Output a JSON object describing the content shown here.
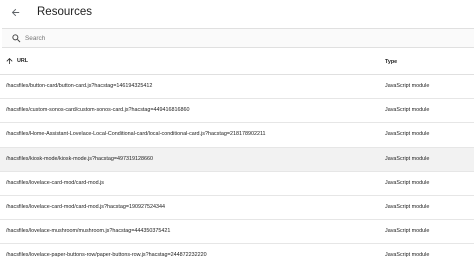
{
  "header": {
    "title": "Resources"
  },
  "search": {
    "placeholder": "Search",
    "value": ""
  },
  "table": {
    "columns": {
      "url": "URL",
      "type": "Type"
    },
    "sort": "ascending",
    "rows": [
      {
        "url": "/hacsfiles/button-card/button-card.js?hacstag=146194325412",
        "type": "JavaScript module"
      },
      {
        "url": "/hacsfiles/custom-sonos-card/custom-sonos-card.js?hacstag=449416816860",
        "type": "JavaScript module"
      },
      {
        "url": "/hacsfiles/Home-Assistant-Lovelace-Local-Conditional-card/local-conditional-card.js?hacstag=218178902211",
        "type": "JavaScript module"
      },
      {
        "url": "/hacsfiles/kiosk-mode/kiosk-mode.js?hacstag=497319128660",
        "type": "JavaScript module"
      },
      {
        "url": "/hacsfiles/lovelace-card-mod/card-mod.js",
        "type": "JavaScript module"
      },
      {
        "url": "/hacsfiles/lovelace-card-mod/card-mod.js?hacstag=190927524344",
        "type": "JavaScript module"
      },
      {
        "url": "/hacsfiles/lovelace-mushroom/mushroom.js?hacstag=444350375421",
        "type": "JavaScript module"
      },
      {
        "url": "/hacsfiles/lovelace-paper-buttons-row/paper-buttons-row.js?hacstag=244872232220",
        "type": "JavaScript module"
      }
    ]
  },
  "icons": {
    "back": "arrow-left-icon",
    "search": "magnify-icon",
    "sort": "arrow-up-icon"
  },
  "colors": {
    "text": "#212121",
    "divider": "#e0e0e0",
    "row_highlight": "#f2f2f2"
  }
}
